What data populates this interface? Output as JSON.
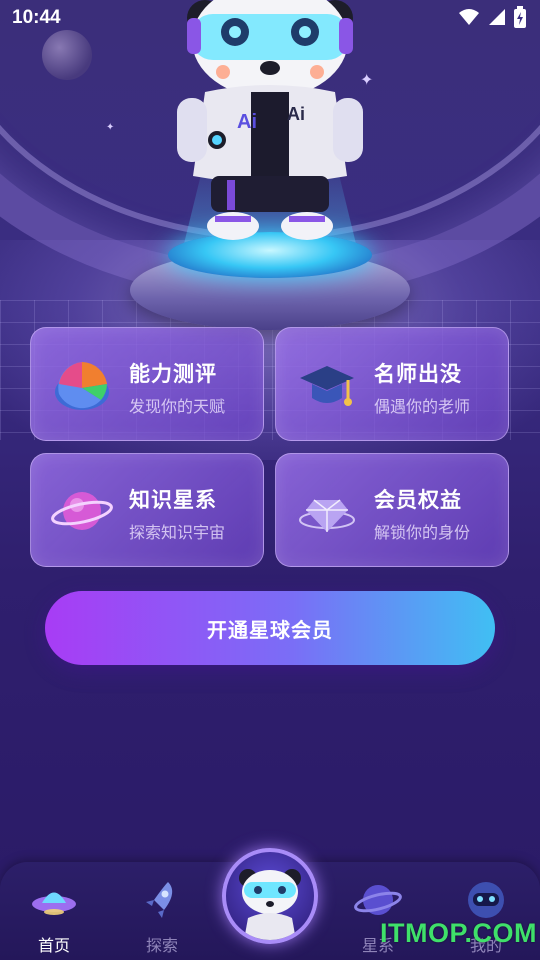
{
  "status_bar": {
    "time": "10:44"
  },
  "cards": [
    {
      "title": "能力测评",
      "subtitle": "发现你的天赋",
      "icon": "pie-chart-icon"
    },
    {
      "title": "名师出没",
      "subtitle": "偶遇你的老师",
      "icon": "graduation-cap-icon"
    },
    {
      "title": "知识星系",
      "subtitle": "探索知识宇宙",
      "icon": "planet-icon"
    },
    {
      "title": "会员权益",
      "subtitle": "解锁你的身份",
      "icon": "diamond-icon"
    }
  ],
  "cta": {
    "label": "开通星球会员"
  },
  "tabbar": {
    "tabs": [
      {
        "label": "首页",
        "icon": "ufo-icon",
        "active": true
      },
      {
        "label": "探索",
        "icon": "rocket-icon",
        "active": false
      },
      {
        "label": "星系",
        "icon": "planet-icon",
        "active": false
      },
      {
        "label": "我的",
        "icon": "robot-face-icon",
        "active": false
      }
    ]
  },
  "watermark": "ITMOP.COM",
  "colors": {
    "background": "#3a2d83",
    "cta_start": "#a83cf5",
    "cta_end": "#40bff3",
    "watermark": "#3fe06a"
  }
}
